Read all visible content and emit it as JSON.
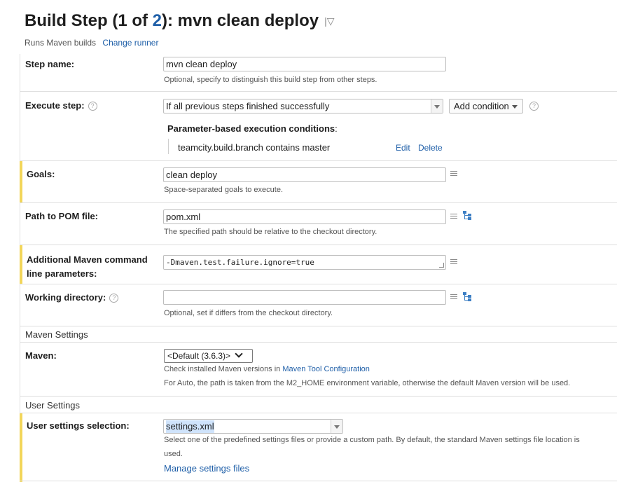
{
  "header": {
    "title_prefix": "Build Step (1 of ",
    "title_num": "2",
    "title_suffix": "): mvn clean deploy",
    "menu_mark": "|▽",
    "runner_text": "Runs Maven builds",
    "change_runner": "Change runner"
  },
  "step_name": {
    "label": "Step name:",
    "value": "mvn clean deploy",
    "hint": "Optional, specify to distinguish this build step from other steps."
  },
  "execute_step": {
    "label": "Execute step:",
    "help": "?",
    "value": "If all previous steps finished successfully",
    "add_condition": "Add condition",
    "conditions_title": "Parameter-based execution conditions",
    "conditions_colon": ":",
    "condition": "teamcity.build.branch contains master",
    "edit": "Edit",
    "delete": "Delete"
  },
  "goals": {
    "label": "Goals:",
    "value": "clean deploy",
    "hint": "Space-separated goals to execute."
  },
  "pom": {
    "label": "Path to POM file:",
    "value": "pom.xml",
    "hint": "The specified path should be relative to the checkout directory."
  },
  "additional": {
    "label_line1": "Additional Maven command",
    "label_line2": "line parameters:",
    "value": "-Dmaven.test.failure.ignore=true"
  },
  "working_dir": {
    "label": "Working directory:",
    "help": "?",
    "value": "",
    "hint": "Optional, set if differs from the checkout directory."
  },
  "maven_settings": {
    "section": "Maven Settings",
    "label": "Maven:",
    "value": "<Default (3.6.3)>",
    "hint_prefix": "Check installed Maven versions in ",
    "hint_link": "Maven Tool Configuration",
    "hint2": "For Auto, the path is taken from the M2_HOME environment variable, otherwise the default Maven version will be used."
  },
  "user_settings": {
    "section": "User Settings",
    "label": "User settings selection:",
    "value": "settings.xml",
    "hint_line1": "Select one of the predefined settings files or provide a custom path. By default, the standard Maven settings file location is",
    "hint_line2": "used.",
    "manage": "Manage settings files"
  },
  "colors": {
    "accent_link": "#1f5fa8",
    "highlight_bar": "#f2d65a",
    "divider": "#dfdfdf"
  },
  "icons": [
    "list-icon",
    "tree-icon",
    "help-icon",
    "dropdown-arrow-icon"
  ]
}
